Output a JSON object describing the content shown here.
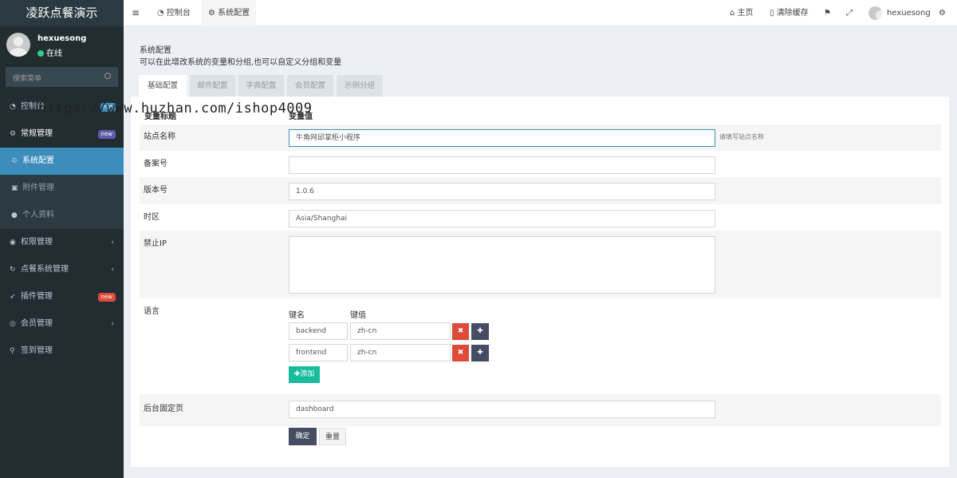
{
  "app": {
    "title": "凌跃点餐演示"
  },
  "user": {
    "name": "hexuesong",
    "status": "在线"
  },
  "search": {
    "placeholder": "搜索菜单"
  },
  "sidebar": {
    "items": [
      {
        "label": "控制台",
        "badge": "hot"
      },
      {
        "label": "常规管理",
        "badge": "new"
      },
      {
        "label": "系统配置"
      },
      {
        "label": "附件管理"
      },
      {
        "label": "个人资料"
      },
      {
        "label": "权限管理"
      },
      {
        "label": "点餐系统管理"
      },
      {
        "label": "插件管理",
        "badge": "new"
      },
      {
        "label": "会员管理"
      },
      {
        "label": "签到管理"
      }
    ]
  },
  "topbar": {
    "tabs": [
      "控制台",
      "系统配置"
    ],
    "home": "主页",
    "clear_cache": "清除缓存",
    "username": "hexuesong"
  },
  "page": {
    "title": "系统配置",
    "description": "可以在此增改系统的变量和分组,也可以自定义分组和变量"
  },
  "tabs": [
    "基础配置",
    "邮件配置",
    "字典配置",
    "会员配置",
    "示例分组"
  ],
  "table": {
    "col_title": "变量标题",
    "col_value": "变量值"
  },
  "fields": {
    "site_name": {
      "label": "站点名称",
      "value": "牛角网邱掌柜小程序",
      "hint": "请填写站点名称"
    },
    "beian": {
      "label": "备案号",
      "value": ""
    },
    "version": {
      "label": "版本号",
      "value": "1.0.6"
    },
    "timezone": {
      "label": "时区",
      "value": "Asia/Shanghai"
    },
    "forbidden_ip": {
      "label": "禁止IP",
      "value": ""
    },
    "language": {
      "label": "语言",
      "key_header": "键名",
      "value_header": "键值",
      "rows": [
        {
          "key": "backend",
          "value": "zh-cn"
        },
        {
          "key": "frontend",
          "value": "zh-cn"
        }
      ],
      "add_label": "添加"
    },
    "fixed_page": {
      "label": "后台固定页",
      "value": "dashboard"
    }
  },
  "buttons": {
    "submit": "确定",
    "reset": "重置"
  },
  "watermark": "https://www.huzhan.com/ishop4009",
  "colors": {
    "sidebar": "#222d32",
    "accent": "#3c8dbc",
    "danger": "#dd4b39",
    "success": "#00a65a",
    "dark": "#444d64"
  }
}
